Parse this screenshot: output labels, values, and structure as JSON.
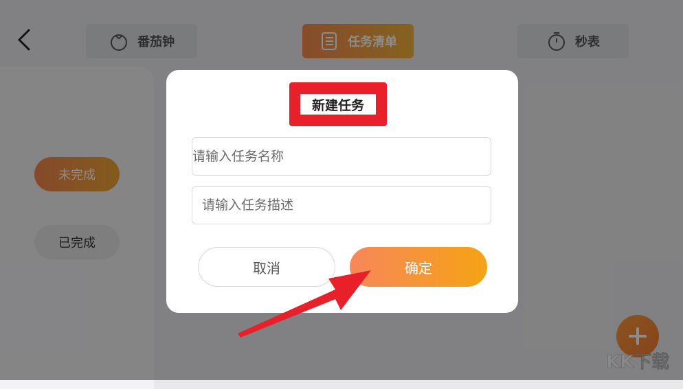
{
  "header": {
    "tabs": [
      {
        "label": "番茄钟",
        "icon": "tomato-icon",
        "active": false
      },
      {
        "label": "任务清单",
        "icon": "checklist-icon",
        "active": true
      },
      {
        "label": "秒表",
        "icon": "stopwatch-icon",
        "active": false
      }
    ]
  },
  "sidebar": {
    "filters": [
      {
        "label": "未完成",
        "active": true
      },
      {
        "label": "已完成",
        "active": false
      }
    ]
  },
  "dialog": {
    "title": "新建任务",
    "name_placeholder": "请输入任务名称",
    "desc_placeholder": "请输入任务描述",
    "cancel_label": "取消",
    "confirm_label": "确定"
  },
  "colors": {
    "accent_start": "#f58a50",
    "accent_end": "#f4a314",
    "highlight_red": "#e8202a",
    "fab": "#f88a36"
  },
  "fab": {
    "icon": "plus-icon"
  },
  "watermark": {
    "text": "KK下载"
  }
}
